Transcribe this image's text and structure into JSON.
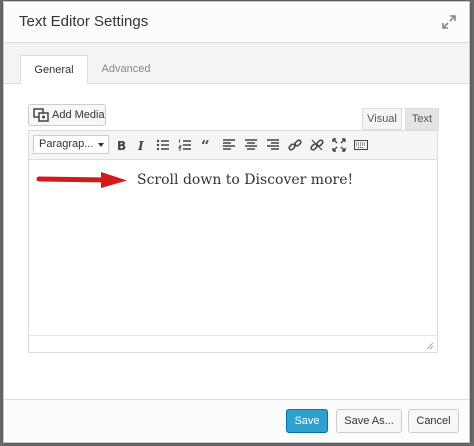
{
  "dialog": {
    "title": "Text Editor Settings",
    "expand_icon": "expand-icon"
  },
  "tabs": [
    {
      "label": "General",
      "active": true
    },
    {
      "label": "Advanced",
      "active": false
    }
  ],
  "editor": {
    "add_media_label": "Add Media",
    "mode_visual": "Visual",
    "mode_text": "Text",
    "format_select_value": "Paragrap...",
    "toolbar_icons": [
      "bold-icon",
      "italic-icon",
      "bullet-list-icon",
      "numbered-list-icon",
      "blockquote-icon",
      "align-left-icon",
      "align-center-icon",
      "align-right-icon",
      "link-icon",
      "unlink-icon",
      "fullscreen-icon",
      "keyboard-icon"
    ],
    "body_text": "Scroll down to Discover more!",
    "arrow_color": "#e02020"
  },
  "footer": {
    "save_label": "Save",
    "save_as_label": "Save As...",
    "cancel_label": "Cancel"
  },
  "colors": {
    "primary": "#2ea2cc"
  }
}
